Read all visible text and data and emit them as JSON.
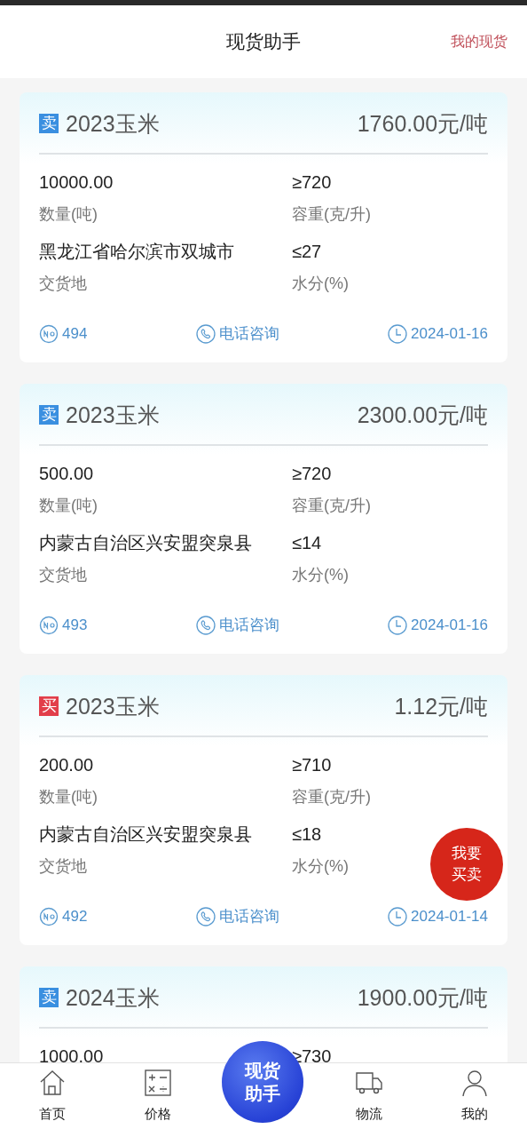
{
  "header": {
    "title": "现货助手",
    "action": "我的现货"
  },
  "listings": [
    {
      "color": "#3a8fe0",
      "tag": "卖",
      "name": "2023玉米",
      "price": "1760.00元/吨",
      "quantity": "10000.00",
      "quantity_label": "数量(吨)",
      "density": "≥720",
      "density_label": "容重(克/升)",
      "location": "黑龙江省哈尔滨市双城市",
      "location_label": "交货地",
      "moisture": "≤27",
      "moisture_label": "水分(%)",
      "number": "494",
      "phone": "电话咨询",
      "date": "2024-01-16"
    },
    {
      "color": "#3a8fe0",
      "tag": "卖",
      "name": "2023玉米",
      "price": "2300.00元/吨",
      "quantity": "500.00",
      "quantity_label": "数量(吨)",
      "density": "≥720",
      "density_label": "容重(克/升)",
      "location": "内蒙古自治区兴安盟突泉县",
      "location_label": "交货地",
      "moisture": "≤14",
      "moisture_label": "水分(%)",
      "number": "493",
      "phone": "电话咨询",
      "date": "2024-01-16"
    },
    {
      "color": "#e23e4a",
      "tag": "买",
      "name": "2023玉米",
      "price": "1.12元/吨",
      "quantity": "200.00",
      "quantity_label": "数量(吨)",
      "density": "≥710",
      "density_label": "容重(克/升)",
      "location": "内蒙古自治区兴安盟突泉县",
      "location_label": "交货地",
      "moisture": "≤18",
      "moisture_label": "水分(%)",
      "number": "492",
      "phone": "电话咨询",
      "date": "2024-01-14"
    },
    {
      "color": "#3a8fe0",
      "tag": "卖",
      "name": "2024玉米",
      "price": "1900.00元/吨",
      "quantity": "1000.00",
      "density": "≥730"
    }
  ],
  "fab": "我要买卖",
  "nav": [
    {
      "kind": "home",
      "label": "首页"
    },
    {
      "kind": "calculator",
      "label": "价格"
    },
    {
      "kind": "center",
      "label": "现货助手"
    },
    {
      "kind": "truck",
      "label": "物流"
    },
    {
      "kind": "person",
      "label": "我的"
    }
  ]
}
